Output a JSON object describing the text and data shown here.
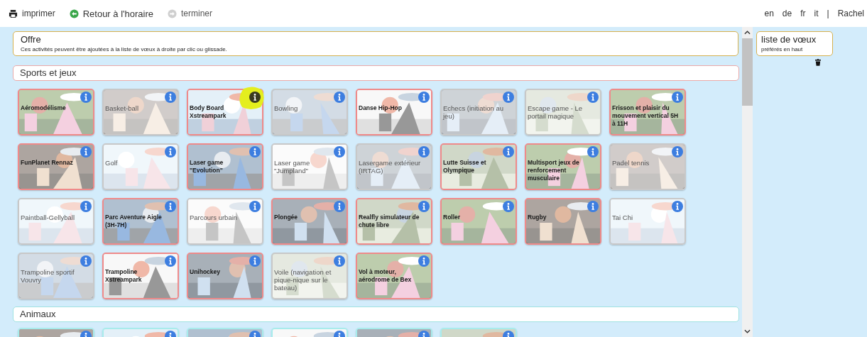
{
  "toolbar": {
    "items": [
      {
        "kind": "print",
        "label": "imprimer",
        "disabled": false
      },
      {
        "kind": "back",
        "label": "Retour à l'horaire",
        "disabled": false
      },
      {
        "kind": "finish",
        "label": "terminer",
        "disabled": true
      }
    ],
    "languages": [
      "en",
      "de",
      "fr",
      "it"
    ],
    "separator": "|",
    "user": "Rachel"
  },
  "offer": {
    "title": "Offre",
    "description": "Ces activités peuvent être ajoutées à la liste de vœux à droite par clic ou glissade."
  },
  "sections": [
    {
      "title": "Sports et jeux",
      "kind": "sports",
      "cards": [
        {
          "title": "Aéromodélisme",
          "available": true,
          "highlighted": false
        },
        {
          "title": "Basket-ball",
          "available": false,
          "highlighted": false
        },
        {
          "title": "Body Board Xstreampark",
          "available": true,
          "highlighted": true
        },
        {
          "title": "Bowling",
          "available": false,
          "highlighted": false
        },
        {
          "title": "Danse Hip-Hop",
          "available": true,
          "highlighted": false
        },
        {
          "title": "Echecs (initiation au jeu)",
          "available": false,
          "highlighted": false
        },
        {
          "title": "Escape game - Le portail magique",
          "available": false,
          "highlighted": false
        },
        {
          "title": "Frisson et plaisir du mouvement vertical 5H à 11H",
          "available": true,
          "highlighted": false
        },
        {
          "title": "FunPlanet Rennaz",
          "available": true,
          "highlighted": false
        },
        {
          "title": "Golf",
          "available": false,
          "highlighted": false
        },
        {
          "title": "Laser game \"Evolution\"",
          "available": true,
          "highlighted": false
        },
        {
          "title": "Laser game \"Jumpland\"",
          "available": false,
          "highlighted": false
        },
        {
          "title": "Lasergame extérieur (IRTAG)",
          "available": false,
          "highlighted": false
        },
        {
          "title": "Lutte Suisse et Olympique",
          "available": true,
          "highlighted": false
        },
        {
          "title": "Multisport jeux de renforcement musculaire",
          "available": true,
          "highlighted": false
        },
        {
          "title": "Padel tennis",
          "available": false,
          "highlighted": false
        },
        {
          "title": "Paintball-Gellyball",
          "available": false,
          "highlighted": false
        },
        {
          "title": "Parc Aventure Aigle (3H-7H)",
          "available": true,
          "highlighted": false
        },
        {
          "title": "Parcours urbain",
          "available": false,
          "highlighted": false
        },
        {
          "title": "Plongée",
          "available": true,
          "highlighted": false
        },
        {
          "title": "Realfly simulateur de chute libre",
          "available": true,
          "highlighted": false
        },
        {
          "title": "Roller",
          "available": true,
          "highlighted": false
        },
        {
          "title": "Rugby",
          "available": true,
          "highlighted": false
        },
        {
          "title": "Tai Chi",
          "available": false,
          "highlighted": false
        },
        {
          "title": "Trampoline sportif Vouvry",
          "available": false,
          "highlighted": false
        },
        {
          "title": "Trampoline Xstreampark",
          "available": true,
          "highlighted": false
        },
        {
          "title": "Unihockey",
          "available": true,
          "highlighted": false
        },
        {
          "title": "Voile (navigation et pique-nique sur le bateau)",
          "available": false,
          "highlighted": false
        },
        {
          "title": "Vol à moteur, aérodrome de Bex",
          "available": true,
          "highlighted": false
        }
      ]
    },
    {
      "title": "Animaux",
      "kind": "animals"
    }
  ],
  "wishlist": {
    "title": "liste de vœux",
    "subtitle": "préférés en haut"
  }
}
